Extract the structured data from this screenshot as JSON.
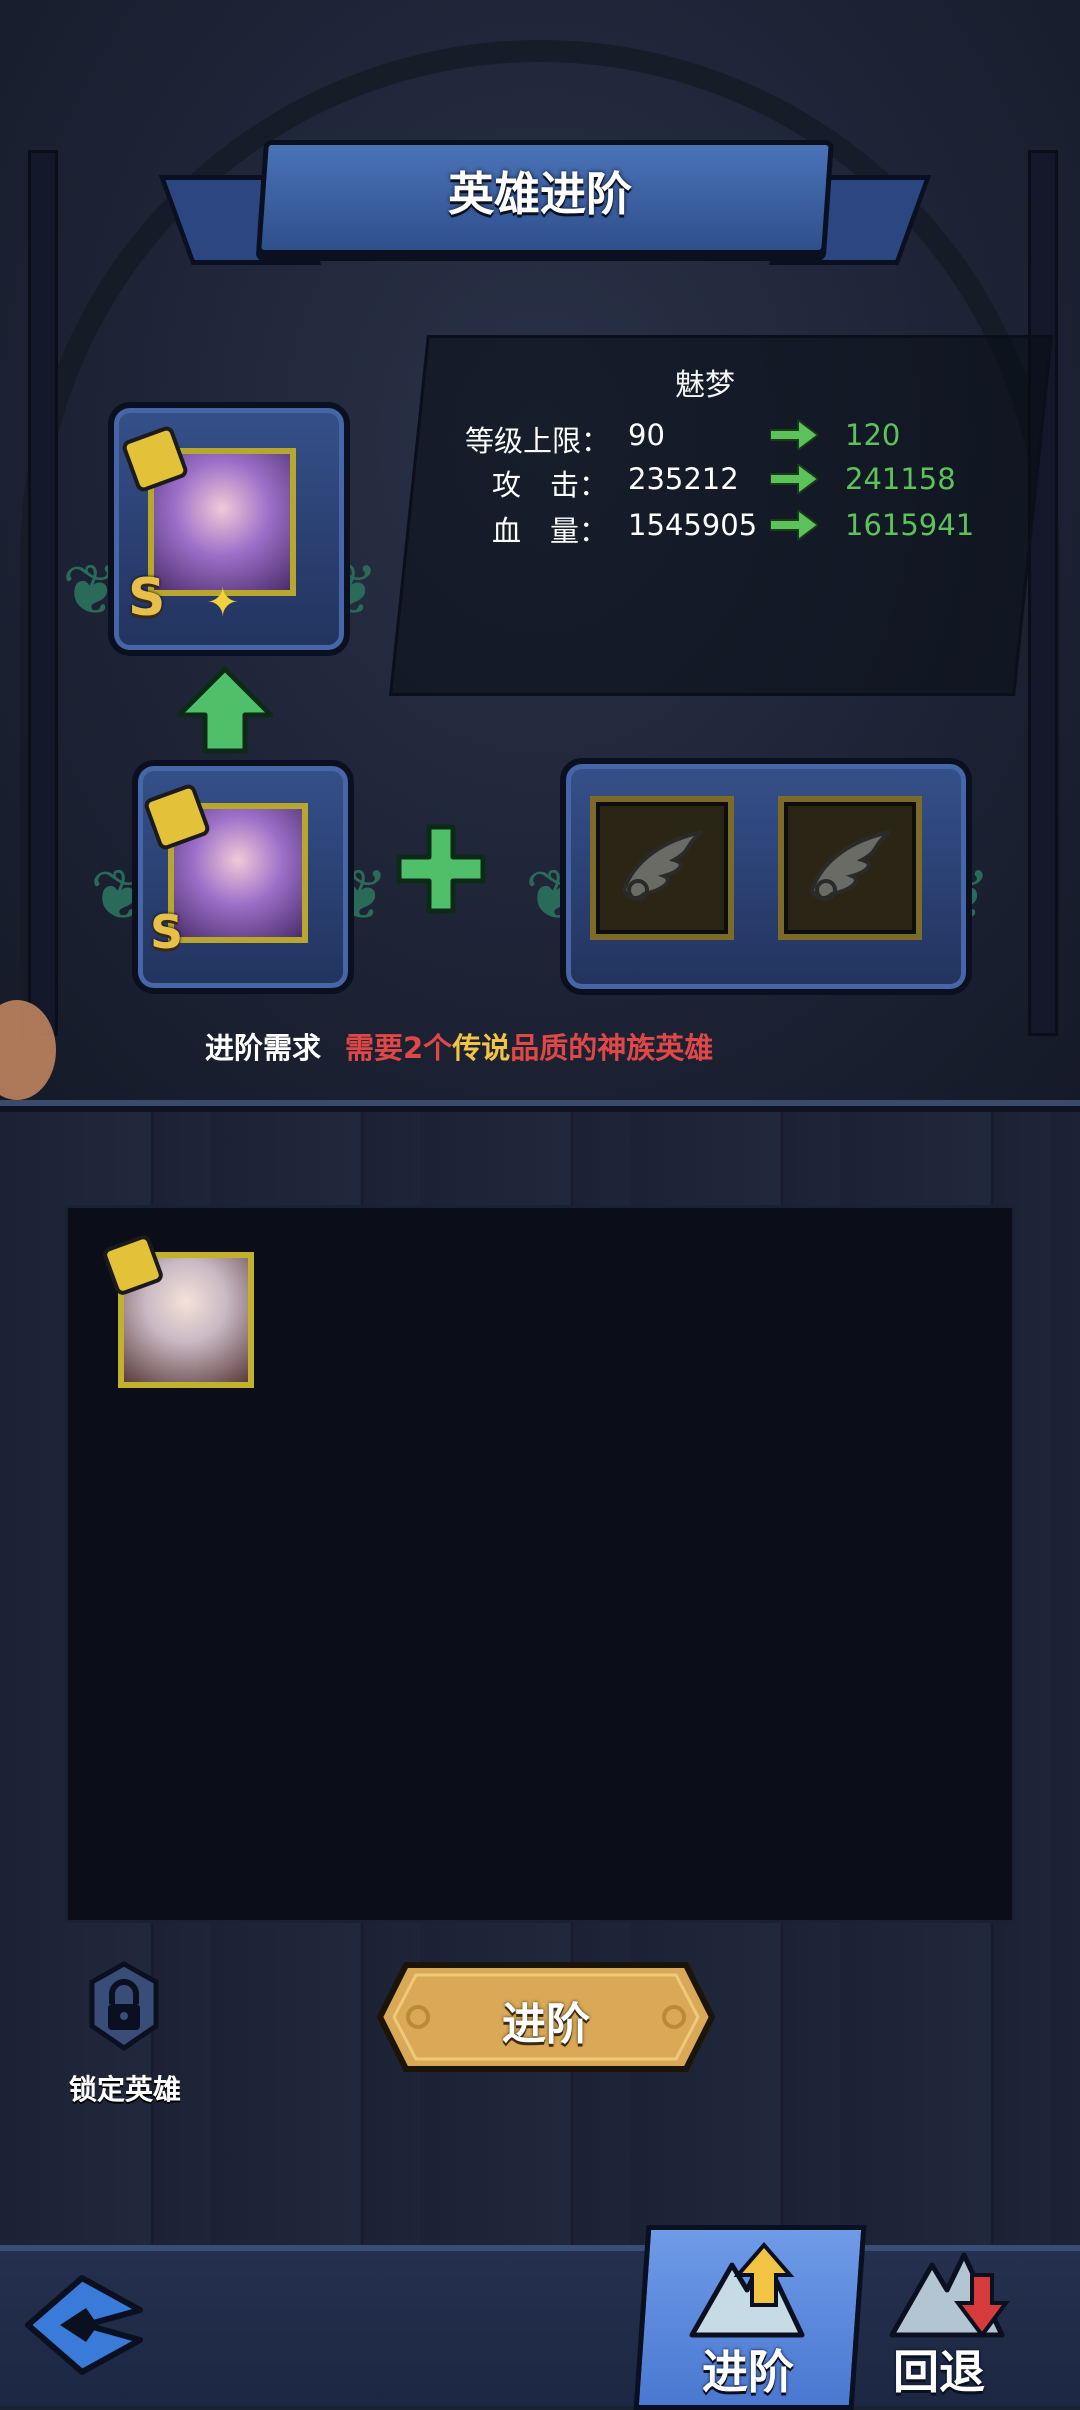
{
  "title": "英雄进阶",
  "hero": {
    "name": "魅梦",
    "rank": "S"
  },
  "stats": [
    {
      "label": "等级上限：",
      "current": "90",
      "next": "120"
    },
    {
      "label": "攻　击：",
      "current": "235212",
      "next": "241158"
    },
    {
      "label": "血　量：",
      "current": "1545905",
      "next": "1615941"
    }
  ],
  "requirement": {
    "label": "进阶需求",
    "text_before": "需要2个",
    "highlight": "传说",
    "text_after": "品质的神族英雄"
  },
  "buttons": {
    "lock_label": "锁定英雄",
    "advance_label": "进阶"
  },
  "nav": {
    "advance_tab": "进阶",
    "revert_tab": "回退"
  },
  "colors": {
    "stat_new": "#5cc35a",
    "requirement_red": "#e04848",
    "requirement_gold": "#f2c443",
    "tab_active": "#5a88dc",
    "button_gold": "#d9a957"
  },
  "icons": {
    "up_arrow": "green-up-arrow-icon",
    "plus": "green-plus-icon",
    "material": "wing-icon",
    "lock": "lock-icon",
    "back": "back-arrow-icon"
  }
}
